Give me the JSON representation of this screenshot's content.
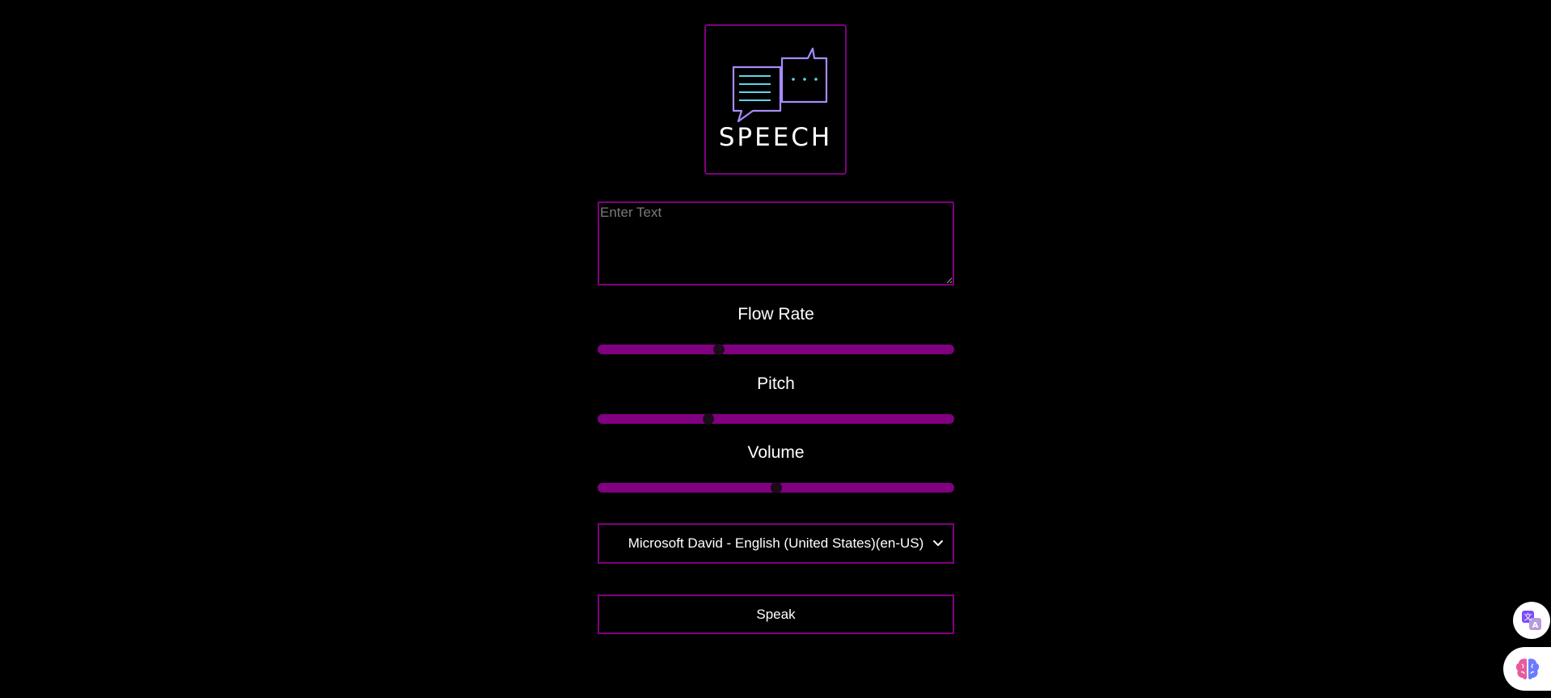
{
  "logo": {
    "text": "SPEECH",
    "icon": "speech-bubbles-icon"
  },
  "text_input": {
    "placeholder": "Enter Text",
    "value": ""
  },
  "sliders": {
    "flow_rate": {
      "label": "Flow Rate",
      "value_fraction": 0.34
    },
    "pitch": {
      "label": "Pitch",
      "value_fraction": 0.31
    },
    "volume": {
      "label": "Volume",
      "value_fraction": 0.5
    }
  },
  "voice_select": {
    "selected": "Microsoft David - English (United States)(en-US)",
    "icon": "chevron-down-icon"
  },
  "speak_button": {
    "label": "Speak"
  },
  "floating_buttons": {
    "translate_icon": "translate-icon",
    "assistant_icon": "brain-icon"
  },
  "colors": {
    "accent": "#800080",
    "background": "#000000",
    "text": "#ffffff"
  }
}
